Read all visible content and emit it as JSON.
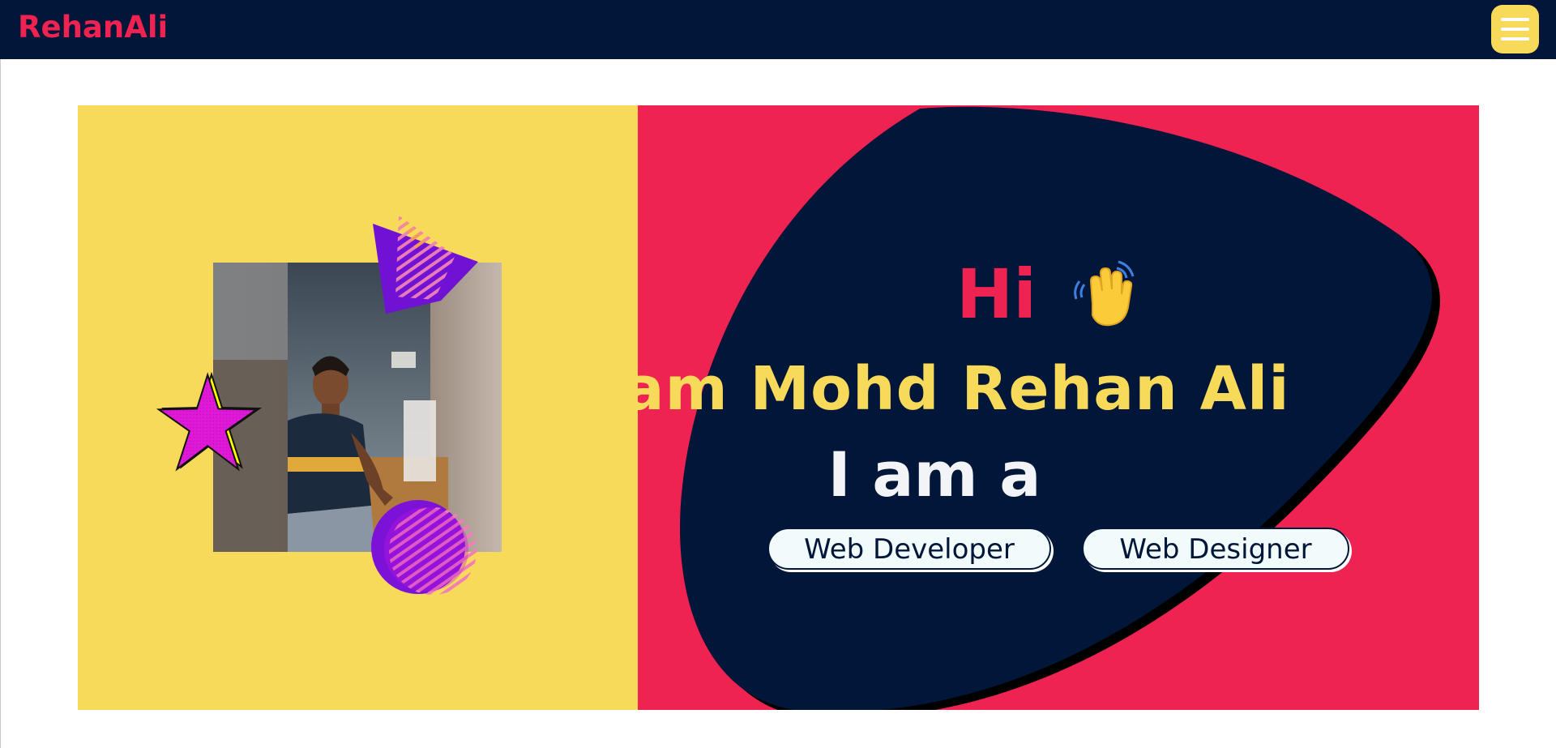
{
  "header": {
    "brand": "RehanAli",
    "menu_icon": "hamburger-icon"
  },
  "colors": {
    "navy": "#011638",
    "red": "#ee2352",
    "yellow": "#f8da5b",
    "white": "#ffffff",
    "magenta": "#e018d8",
    "purple": "#6f12d4"
  },
  "hero": {
    "greeting": "Hi",
    "greeting_icon": "waving-hand-icon",
    "name_line": "I am Mohd Rehan Ali",
    "role_prefix": "I am a",
    "roles": [
      "Web Developer",
      "Web Designer"
    ],
    "photo_icon": "profile-photo"
  }
}
